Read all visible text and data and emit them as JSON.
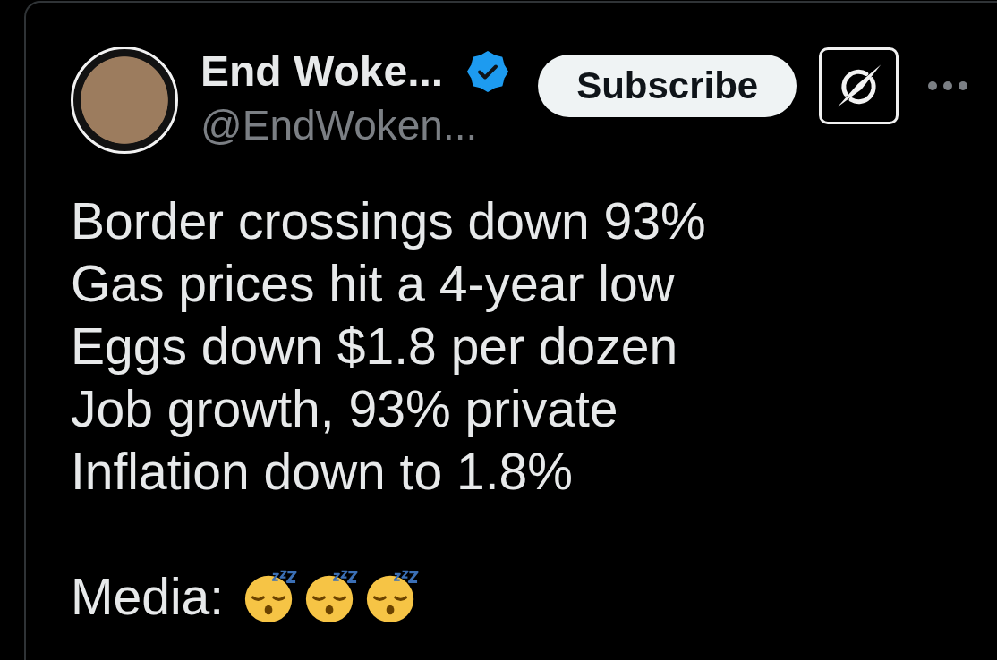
{
  "post": {
    "author": {
      "name": "End Woke...",
      "verified": true,
      "handle": "@EndWoken..."
    },
    "subscribe_button": {
      "label": "Subscribe"
    },
    "text_lines": [
      "Border crossings down 93%",
      "Gas prices hit a 4-year low",
      "Eggs down $1.8 per dozen",
      "Job growth, 93% private",
      "Inflation down to 1.8%"
    ],
    "media_line": {
      "label": "Media:",
      "emojis": [
        {
          "kind": "sleeping"
        },
        {
          "kind": "sleeping"
        },
        {
          "kind": "sleeping"
        }
      ]
    }
  }
}
